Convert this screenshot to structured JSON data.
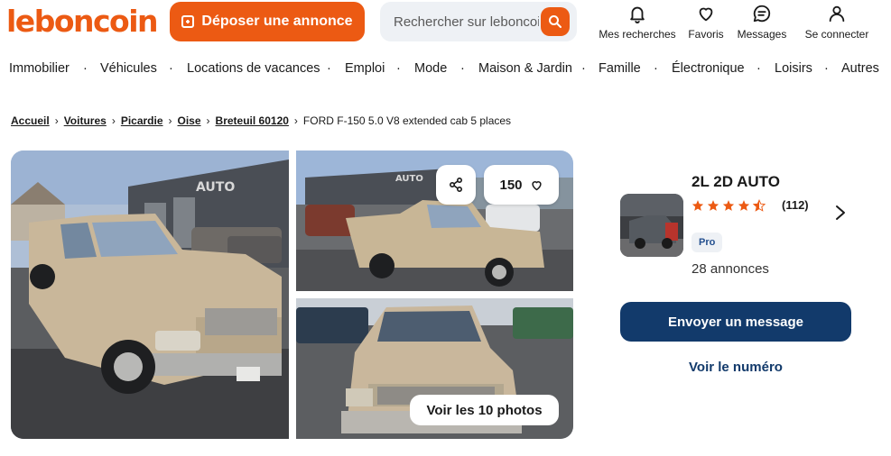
{
  "header": {
    "logo": "leboncoin",
    "post_button": "Déposer une annonce",
    "search_placeholder": "Rechercher sur leboncoin",
    "nav": [
      {
        "label": "Mes recherches",
        "icon": "bell-icon"
      },
      {
        "label": "Favoris",
        "icon": "heart-icon"
      },
      {
        "label": "Messages",
        "icon": "message-icon"
      },
      {
        "label": "Se connecter",
        "icon": "user-icon"
      }
    ]
  },
  "categories": [
    "Immobilier",
    "Véhicules",
    "Locations de vacances",
    "Emploi",
    "Mode",
    "Maison & Jardin",
    "Famille",
    "Électronique",
    "Loisirs",
    "Autres"
  ],
  "breadcrumb": {
    "links": [
      "Accueil",
      "Voitures",
      "Picardie",
      "Oise",
      "Breteuil 60120"
    ],
    "current": "FORD F-150 5.0 V8 extended cab 5 places"
  },
  "gallery": {
    "favorites_count": "150",
    "photos_button": "Voir les 10 photos"
  },
  "seller": {
    "name": "2L 2D AUTO",
    "rating_count": "(112)",
    "rating": 4.5,
    "badge": "Pro",
    "listings": "28 annonces",
    "message_button": "Envoyer un message",
    "phone_link": "Voir le numéro"
  },
  "colors": {
    "brand": "#ec5a13",
    "primary_dark": "#123a6b",
    "star": "#ec5a13"
  }
}
